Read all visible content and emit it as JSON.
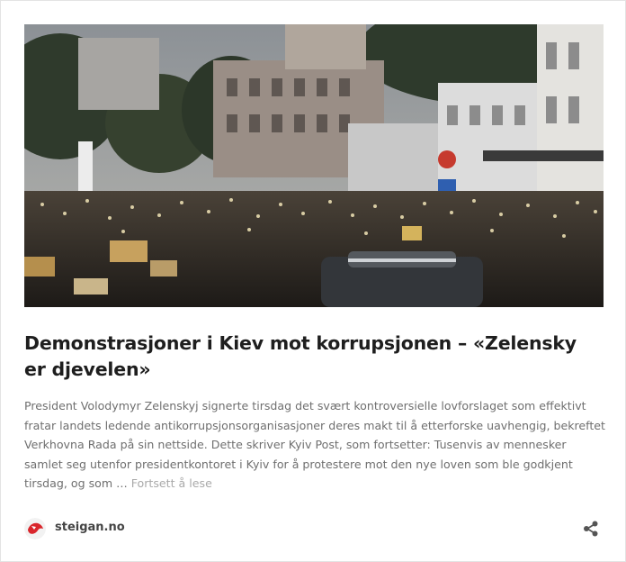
{
  "post": {
    "title": "Demonstrasjoner i Kiev mot korrupsjonen – «Zelensky er djevelen»",
    "excerpt": "President Volodymyr Zelenskyj signerte tirsdag det svært kontroversielle lovforslaget som effektivt fratar landets ledende antikorrupsjonsorganisasjoner deres makt til å etterforske uavhengig, bekreftet Verkhovna Rada på sin nettside. Dette skriver Kyiv Post, som fortsetter: Tusenvis av mennesker samlet seg utenfor presidentkontoret i Kyiv for å protestere mot den nye loven som ble godkjent tirsdag, og som …",
    "read_more": "Fortsett å lese"
  },
  "footer": {
    "site_name": "steigan.no",
    "avatar_icon": "steigan-logo-icon",
    "share_icon": "share-icon"
  },
  "colors": {
    "title": "#1e1e1e",
    "excerpt": "#6f6f6f",
    "read_more": "#a9a9a9",
    "logo_red": "#d9262c"
  }
}
